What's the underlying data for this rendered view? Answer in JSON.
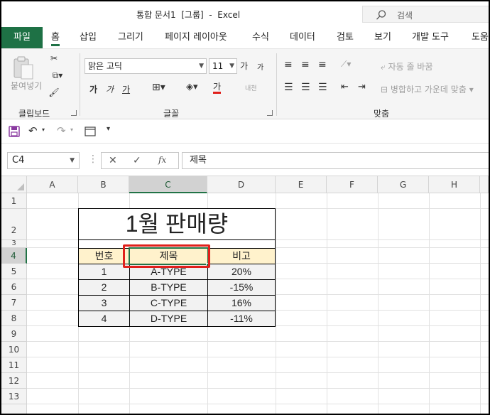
{
  "window": {
    "title": "통합 문서1  [그룹]  -  Excel",
    "search_placeholder": "검색"
  },
  "tabs": [
    {
      "label": "파일"
    },
    {
      "label": "홈"
    },
    {
      "label": "삽입"
    },
    {
      "label": "그리기"
    },
    {
      "label": "페이지 레이아웃"
    },
    {
      "label": "수식"
    },
    {
      "label": "데이터"
    },
    {
      "label": "검토"
    },
    {
      "label": "보기"
    },
    {
      "label": "개발 도구"
    },
    {
      "label": "도움"
    }
  ],
  "ribbon": {
    "clipboard": {
      "paste_label": "붙여넣기",
      "group_label": "클립보드"
    },
    "font": {
      "font_name": "맑은 고딕",
      "font_size": "11",
      "grow": "가",
      "shrink": "가",
      "bold": "가",
      "italic": "가",
      "underline": "가",
      "font_color_glyph": "가",
      "phonetic": "내천",
      "group_label": "글꼴"
    },
    "alignment": {
      "wrap_text": "자동 줄 바꿈",
      "merge_center": "병합하고 가운데 맞춤",
      "group_label": "맞춤"
    }
  },
  "formula_bar": {
    "name_box": "C4",
    "fx": "fx",
    "value": "제목"
  },
  "sheet": {
    "columns": [
      "A",
      "B",
      "C",
      "D",
      "E",
      "F",
      "G",
      "H"
    ],
    "rows": [
      "1",
      "2",
      "3",
      "4",
      "5",
      "6",
      "7",
      "8",
      "9",
      "10",
      "11",
      "12",
      "13"
    ],
    "selected_column": "C",
    "selected_row": "4",
    "title_cell": "1월 판매량",
    "headers": [
      "번호",
      "제목",
      "비고"
    ],
    "data": [
      [
        "1",
        "A-TYPE",
        "20%"
      ],
      [
        "2",
        "B-TYPE",
        "-15%"
      ],
      [
        "3",
        "C-TYPE",
        "16%"
      ],
      [
        "4",
        "D-TYPE",
        "-11%"
      ]
    ]
  },
  "colors": {
    "accent": "#1e7145",
    "header_fill": "#fff2cc",
    "data_fill": "#f2f2f2",
    "highlight": "#e0201b",
    "selection": "#217346"
  }
}
